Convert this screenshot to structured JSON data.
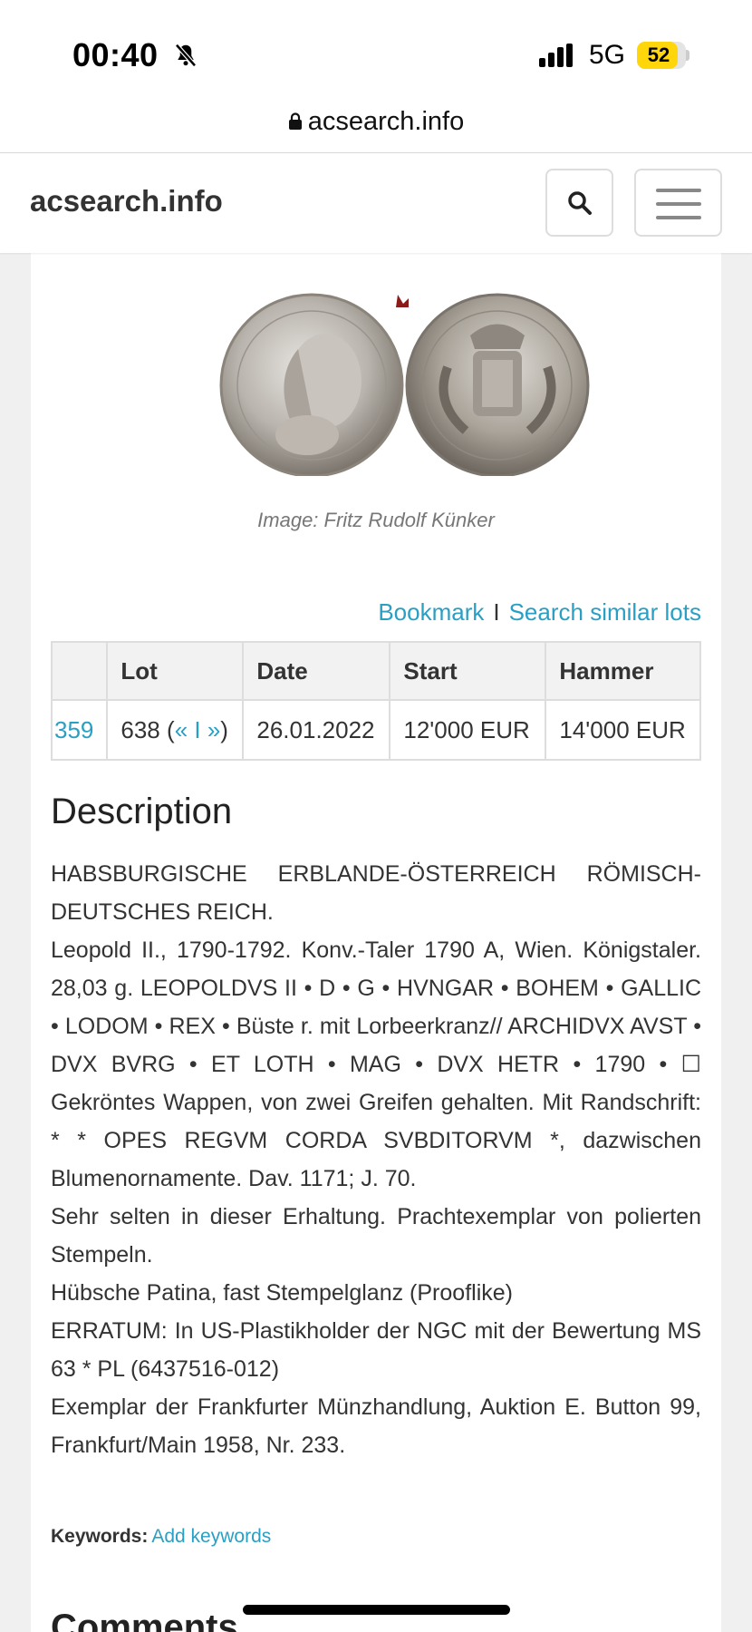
{
  "status_bar": {
    "time": "00:40",
    "network": "5G",
    "battery": "52",
    "battery_level": 0.52
  },
  "browser": {
    "url": "acsearch.info"
  },
  "navbar": {
    "brand": "acsearch.info",
    "search_icon": "search-icon",
    "menu_icon": "hamburger-icon"
  },
  "lot": {
    "image_caption": "Image: Fritz Rudolf Künker",
    "actions": {
      "bookmark": "Bookmark",
      "separator": "I",
      "search_similar": "Search similar lots"
    },
    "table": {
      "headers": [
        "",
        "Lot",
        "Date",
        "Start",
        "Hammer"
      ],
      "row": {
        "auction": "359",
        "lot": "638",
        "lot_nav_open": "(",
        "lot_nav_links": "« I »",
        "lot_nav_close": ")",
        "date": "26.01.2022",
        "start": "12'000 EUR",
        "hammer": "14'000 EUR"
      }
    }
  },
  "description": {
    "title": "Description",
    "paragraphs": [
      "HABSBURGISCHE ERBLANDE-ÖSTERREICH RÖMISCH-DEUTSCHES REICH.",
      "Leopold II., 1790-1792. Konv.-Taler 1790 A, Wien. Königstaler. 28,03 g. LEOPOLDVS II • D • G • HVNGAR • BOHEM • GALLIC • LODOM • REX • Büste r. mit Lorbeerkranz// ARCHIDVX AVST • DVX BVRG • ET LOTH • MAG • DVX HETR • 1790 • ☐ Gekröntes Wappen, von zwei Greifen gehalten. Mit Randschrift: * * OPES REGVM CORDA SVBDITORVM *, dazwischen Blumenornamente. Dav. 1171; J. 70.",
      "Sehr selten in dieser Erhaltung. Prachtexemplar von polierten Stempeln.",
      "Hübsche Patina, fast Stempelglanz (Prooflike)",
      "ERRATUM: In US-Plastikholder der NGC mit der Bewertung MS 63 * PL (6437516-012)",
      "Exemplar der Frankfurter Münzhandlung, Auktion E. Button 99, Frankfurt/Main 1958, Nr. 233."
    ],
    "keywords_label": "Keywords:",
    "keywords_link": "Add keywords"
  },
  "comments": {
    "title": "Comments"
  },
  "colors": {
    "link": "#2a9fc4",
    "text": "#333333",
    "page_bg": "#f0f0f0",
    "battery": "#ffd60a"
  }
}
